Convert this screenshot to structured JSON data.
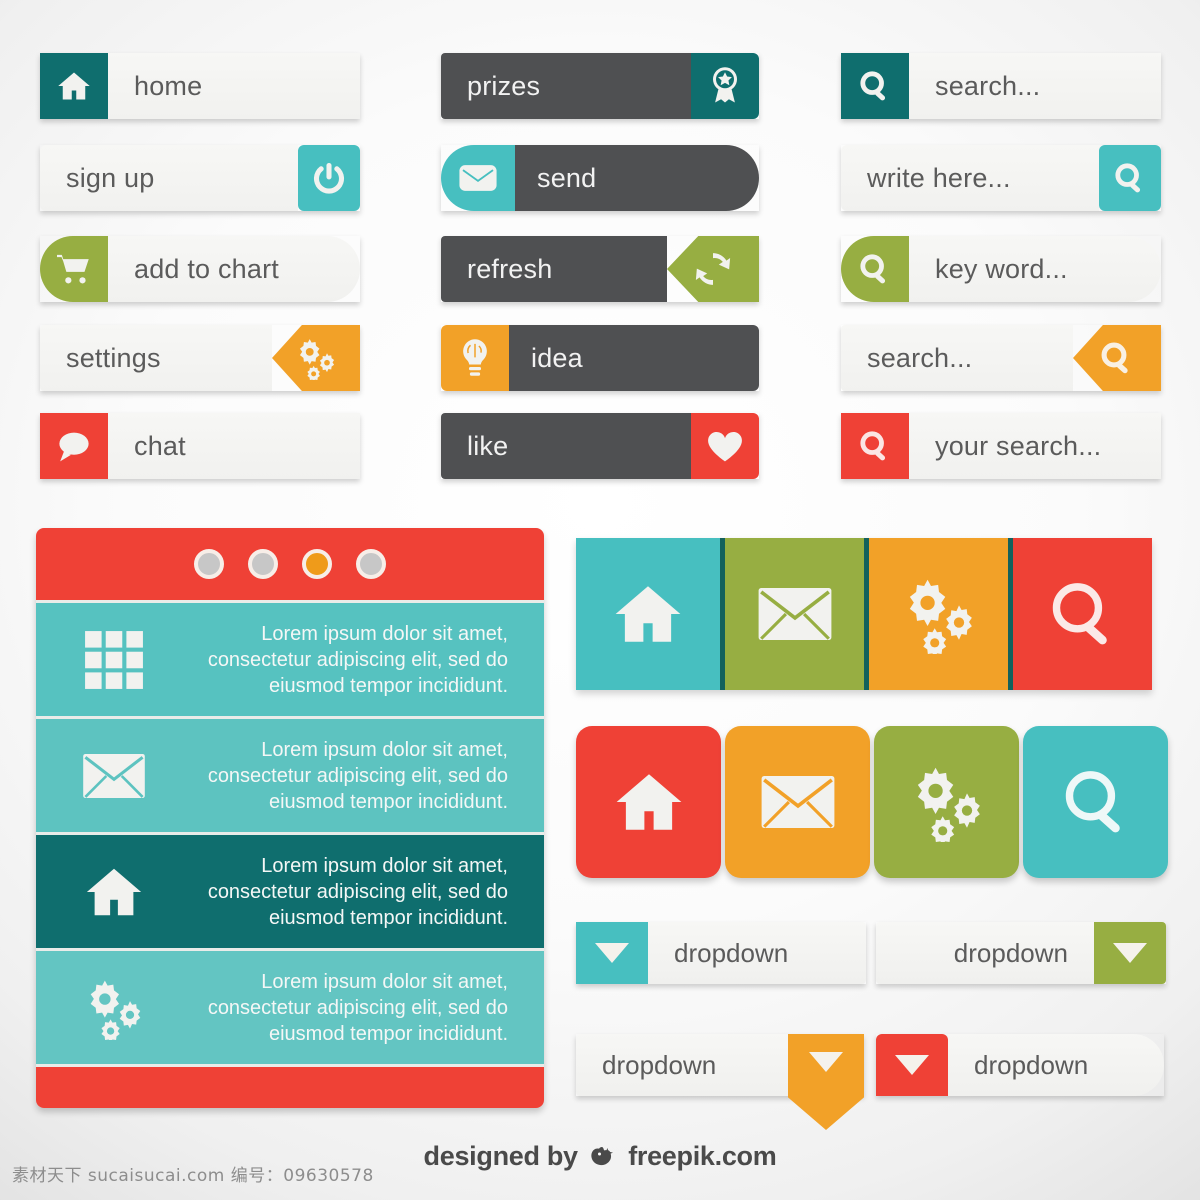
{
  "palette": {
    "teal": "#0f6e6e",
    "cyan": "#47bfc0",
    "olive": "#97ae42",
    "orange": "#f2a128",
    "red": "#ef4136",
    "dark": "#4f5052",
    "light": "#f3f3f1"
  },
  "buttons": {
    "home": {
      "label": "home",
      "icon": "home-icon",
      "icon_color": "teal"
    },
    "signup": {
      "label": "sign up",
      "icon": "power-icon",
      "icon_color": "cyan"
    },
    "addtochart": {
      "label": "add to chart",
      "icon": "cart-icon",
      "icon_color": "olive"
    },
    "settings": {
      "label": "settings",
      "icon": "gears-icon",
      "icon_color": "orange"
    },
    "chat": {
      "label": "chat",
      "icon": "chat-bubble-icon",
      "icon_color": "red"
    },
    "prizes": {
      "label": "prizes",
      "icon": "award-ribbon-icon",
      "icon_color": "teal"
    },
    "send": {
      "label": "send",
      "icon": "envelope-icon",
      "icon_color": "cyan"
    },
    "refresh": {
      "label": "refresh",
      "icon": "refresh-icon",
      "icon_color": "olive"
    },
    "idea": {
      "label": "idea",
      "icon": "lightbulb-icon",
      "icon_color": "orange"
    },
    "like": {
      "label": "like",
      "icon": "heart-icon",
      "icon_color": "red"
    }
  },
  "searchfields": {
    "search_teal": {
      "value": "search...",
      "icon": "search-icon",
      "icon_color": "teal"
    },
    "write_here": {
      "value": "write here...",
      "icon": "search-icon",
      "icon_color": "cyan"
    },
    "key_word": {
      "value": "key word...",
      "icon": "search-icon",
      "icon_color": "olive"
    },
    "search_orange": {
      "value": "search...",
      "icon": "search-icon",
      "icon_color": "orange"
    },
    "your_search": {
      "value": "your search...",
      "icon": "search-icon",
      "icon_color": "red"
    }
  },
  "accordion": {
    "dots": [
      {
        "name": "dot-1",
        "active": false
      },
      {
        "name": "dot-2",
        "active": false
      },
      {
        "name": "dot-3",
        "active": true
      },
      {
        "name": "dot-4",
        "active": false
      }
    ],
    "active_dot_color": "#ef9b1a",
    "inactive_dot_color": "#c7c7c7",
    "rows": [
      {
        "icon": "grid-icon",
        "text": "Lorem ipsum dolor sit amet, consectetur adipiscing elit, sed do eiusmod tempor incididunt."
      },
      {
        "icon": "envelope-icon",
        "text": "Lorem ipsum dolor sit amet, consectetur adipiscing elit, sed do eiusmod tempor incididunt."
      },
      {
        "icon": "home-icon",
        "text": "Lorem ipsum dolor sit amet, consectetur adipiscing elit, sed do eiusmod tempor incididunt."
      },
      {
        "icon": "gears-icon",
        "text": "Lorem ipsum dolor sit amet, consectetur adipiscing elit, sed do eiusmod tempor incididunt."
      }
    ]
  },
  "tiles_flat": [
    {
      "icon": "home-icon",
      "color": "cyan"
    },
    {
      "icon": "envelope-icon",
      "color": "olive"
    },
    {
      "icon": "gears-icon",
      "color": "orange"
    },
    {
      "icon": "search-icon",
      "color": "red"
    }
  ],
  "tiles_rounded": [
    {
      "icon": "home-icon",
      "color": "red"
    },
    {
      "icon": "envelope-icon",
      "color": "orange"
    },
    {
      "icon": "gears-icon",
      "color": "olive"
    },
    {
      "icon": "search-icon",
      "color": "cyan"
    }
  ],
  "dropdowns": [
    {
      "label": "dropdown",
      "icon": "caret-down-icon",
      "color": "cyan",
      "side": "left"
    },
    {
      "label": "dropdown",
      "icon": "caret-down-icon",
      "color": "olive",
      "side": "right"
    },
    {
      "label": "dropdown",
      "icon": "caret-down-icon",
      "color": "orange",
      "side": "right"
    },
    {
      "label": "dropdown",
      "icon": "caret-down-icon",
      "color": "red",
      "side": "left"
    }
  ],
  "footer": {
    "cn_text": "素材天下 sucaisucai.com  编号：09630578",
    "designed_prefix": "designed by",
    "designed_brand": "freepik.com"
  }
}
